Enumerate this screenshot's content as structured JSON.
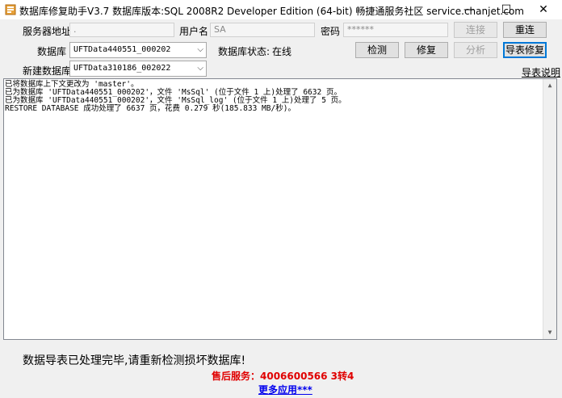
{
  "window": {
    "title": "数据库修复助手V3.7 数据库版本:SQL 2008R2 Developer Edition (64-bit)  畅捷通服务社区 service.chanjet.com",
    "minimize": "—",
    "maximize": "☐",
    "close": "✕"
  },
  "connection": {
    "server_label": "服务器地址",
    "server_value": ".",
    "user_label": "用户名",
    "user_value": "SA",
    "password_label": "密码",
    "password_value": "******",
    "connect_button": "连接",
    "reconnect_button": "重连"
  },
  "database": {
    "db_label": "数据库",
    "db_value": "UFTData440551_000202",
    "status_label": "数据库状态:",
    "status_value": "在线",
    "check_button": "检测",
    "repair_button": "修复",
    "analyze_button": "分析",
    "export_repair_button": "导表修复"
  },
  "new_database": {
    "label": "新建数据库",
    "value": "UFTData310186_002022",
    "export_help_link": "导表说明"
  },
  "log": {
    "lines": [
      "已将数据库上下文更改为 'master'。",
      "已为数据库 'UFTData440551_000202'，文件 'MsSql' (位于文件 1 上)处理了 6632 页。",
      "已为数据库 'UFTData440551_000202'，文件 'MsSql_log' (位于文件 1 上)处理了 5 页。",
      "RESTORE DATABASE 成功处理了 6637 页，花费 0.279 秒(185.833 MB/秒)。"
    ],
    "scroll_up": "▲",
    "scroll_down": "▼"
  },
  "footer": {
    "message": "数据导表已处理完毕,请重新检测损坏数据库!",
    "support": "售后服务：4006600566 3转4",
    "more_apps": "更多应用***"
  }
}
